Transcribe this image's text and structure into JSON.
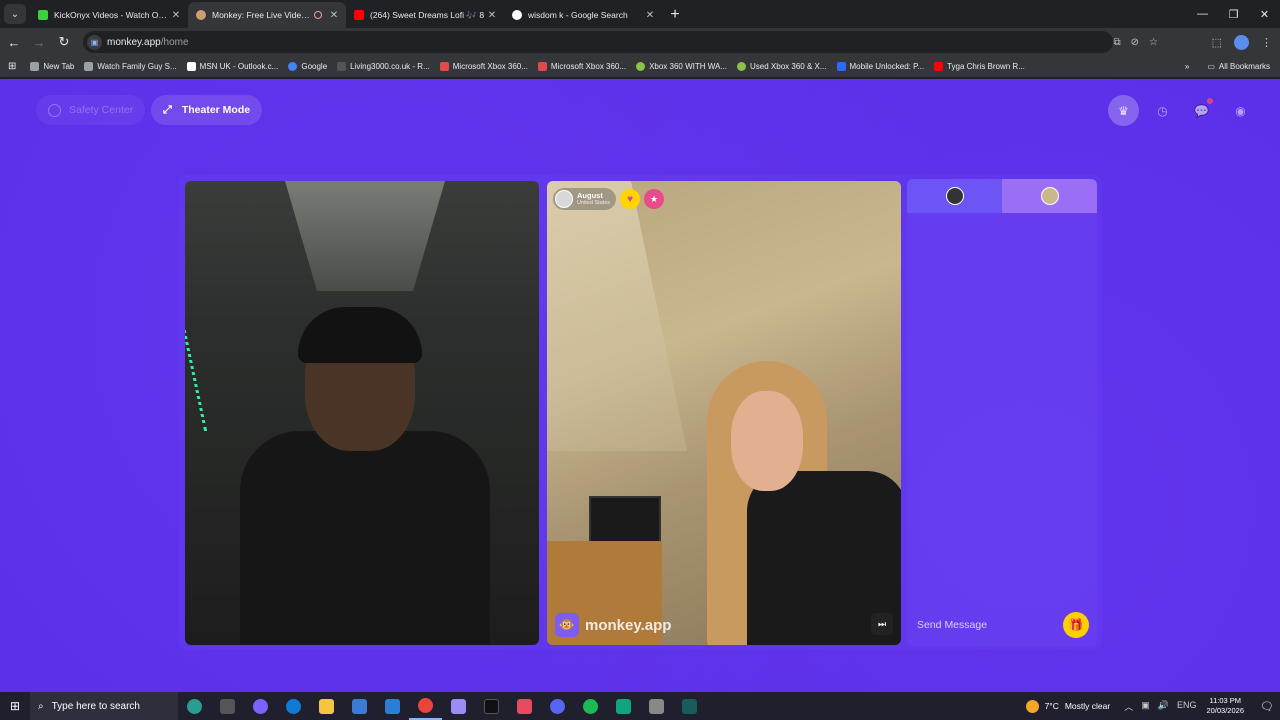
{
  "browser": {
    "tabs": [
      {
        "title": "KickOnyx Videos - Watch On-D",
        "color": "#3ad13a",
        "active": false
      },
      {
        "title": "Monkey: Free Live Video Ch",
        "color": "#caa070",
        "active": true
      },
      {
        "title": "(264) Sweet Dreams Lofi 🎶 8",
        "color": "#ff0000",
        "active": false
      },
      {
        "title": "wisdom k - Google Search",
        "color": "#ffffff",
        "active": false
      }
    ],
    "url_host": "monkey.app",
    "url_path": "/home",
    "bookmarks": [
      {
        "label": "New Tab",
        "color": "#9aa0a6"
      },
      {
        "label": "Watch Family Guy S...",
        "color": "#9aa0a6"
      },
      {
        "label": "MSN UK - Outlook.c...",
        "color": "#ffffff"
      },
      {
        "label": "Google",
        "color": "#4285f4"
      },
      {
        "label": "Living3000.co.uk - R...",
        "color": "#555555"
      },
      {
        "label": "Microsoft Xbox 360...",
        "color": "#e04a4a"
      },
      {
        "label": "Microsoft Xbox 360...",
        "color": "#e04a4a"
      },
      {
        "label": "Xbox 360 WITH WA...",
        "color": "#8bc34a"
      },
      {
        "label": "Used Xbox 360 & X...",
        "color": "#8bc34a"
      },
      {
        "label": "Mobile Unlocked: P...",
        "color": "#2a6df4"
      },
      {
        "label": "Tyga Chris Brown R...",
        "color": "#ff0000"
      }
    ],
    "all_bookmarks": "All Bookmarks"
  },
  "app": {
    "safety_center": "Safety Center",
    "theater_mode": "Theater Mode",
    "partner": {
      "name": "August",
      "country": "United States"
    },
    "watermark": "monkey.app",
    "chat_placeholder": "Send Message"
  },
  "taskbar": {
    "search_placeholder": "Type here to search",
    "weather_temp": "7°C",
    "weather_desc": "Mostly clear",
    "language": "ENG",
    "time": "11:03 PM",
    "date": "20/03/2026",
    "apps": [
      {
        "name": "edge-icon",
        "color": "#2a9d8f"
      },
      {
        "name": "taskview-icon",
        "color": "#555"
      },
      {
        "name": "copilot-icon",
        "color": "#7b61ff"
      },
      {
        "name": "edge-browser-icon",
        "color": "#0f7bd6"
      },
      {
        "name": "file-explorer-icon",
        "color": "#f5c542"
      },
      {
        "name": "store-icon",
        "color": "#3a7bd5"
      },
      {
        "name": "mail-icon",
        "color": "#2a7fd4"
      },
      {
        "name": "chrome-icon",
        "color": "#e8453c"
      },
      {
        "name": "app-icon",
        "color": "#9b8cf5"
      },
      {
        "name": "tiktok-icon",
        "color": "#111111"
      },
      {
        "name": "app-red-icon",
        "color": "#e84a5f"
      },
      {
        "name": "discord-icon",
        "color": "#5865f2"
      },
      {
        "name": "spotify-icon",
        "color": "#1db954"
      },
      {
        "name": "app-green-icon",
        "color": "#10a37f"
      },
      {
        "name": "app-gray-icon",
        "color": "#888888"
      },
      {
        "name": "app-teal-icon",
        "color": "#1a5c5c"
      }
    ]
  }
}
